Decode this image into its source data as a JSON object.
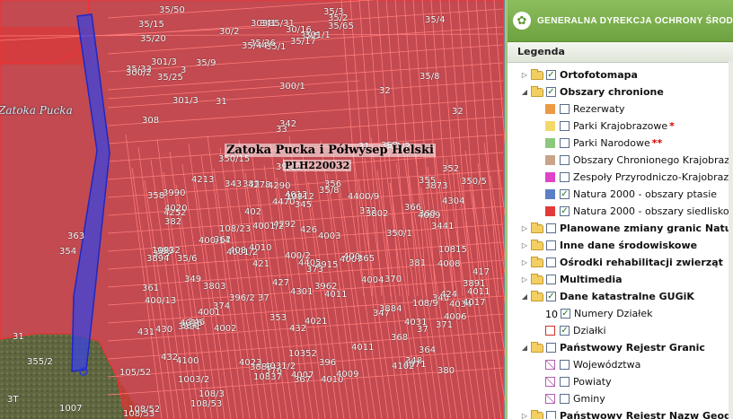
{
  "map": {
    "water_label": "Zatoka Pucka",
    "feature_label": "Zatoka Pucka i Półwysep Helski",
    "feature_code": "PLH220032",
    "colors": {
      "red": "#e23333",
      "blue": "#3a44dd",
      "water": "#6f8599",
      "land": "#6b6b4f"
    },
    "plot_labels": [
      "35/1",
      "35/15",
      "35/36",
      "35/33",
      "35/5",
      "35/9",
      "35/3",
      "35/31",
      "35/2",
      "35/17",
      "35/50",
      "35/8",
      "35/20",
      "35/4",
      "35/44",
      "35/65",
      "35/25",
      "303/1",
      "30/16",
      "301/3",
      "30/2",
      "300/2",
      "3",
      "34",
      "301/1",
      "301/2",
      "301/3",
      "300/1",
      "308",
      "31",
      "32",
      "33",
      "39/12",
      "342",
      "31",
      "32",
      "350/15",
      "355",
      "352",
      "357",
      "356",
      "354",
      "353",
      "350/1",
      "350/5",
      "37",
      "377",
      "417",
      "340",
      "345",
      "348",
      "343",
      "346",
      "347",
      "3441",
      "360",
      "358",
      "361",
      "364",
      "349",
      "363",
      "359",
      "362",
      "366",
      "4213",
      "4400/9",
      "4470",
      "4405",
      "431",
      "432",
      "3883",
      "3884",
      "4001/2",
      "432",
      "3990",
      "400/14",
      "400/13",
      "400/2",
      "396",
      "3915",
      "4100",
      "4004",
      "4006",
      "4007",
      "4008",
      "4021",
      "4071",
      "4010",
      "4011",
      "4012",
      "4011",
      "365",
      "368",
      "373",
      "371",
      "375",
      "367",
      "372",
      "3802",
      "3803",
      "383",
      "3891",
      "3894",
      "4001",
      "4002",
      "4023",
      "4007",
      "4009",
      "421",
      "424",
      "4252",
      "426",
      "427",
      "4278",
      "430",
      "4301",
      "4304",
      "4292",
      "4290",
      "3891",
      "3873",
      "4003",
      "4001/2",
      "370",
      "374",
      "380",
      "376",
      "381",
      "382",
      "384",
      "4009",
      "408",
      "402",
      "4034",
      "4031",
      "396/2",
      "4016",
      "4017",
      "4010",
      "4011",
      "35/6",
      "37",
      "3962",
      "400",
      "4020",
      "4031/2",
      "4102",
      "10352",
      "10812",
      "10815",
      "108/23",
      "10832",
      "10837",
      "108/9",
      "35/8"
    ],
    "bottom_plots": [
      "1003/2",
      "105/52",
      "108/3",
      "108/53",
      "108/52",
      "1007",
      "108/53",
      "355/2",
      "31",
      "3T"
    ]
  },
  "panel": {
    "agency": "GENERALNA DYREKCJA OCHRONY ŚRODOWISKA",
    "legend_title": "Legenda",
    "items": [
      {
        "label": "Ortofotomapa",
        "type": "group",
        "checked": true,
        "expanded": false
      },
      {
        "label": "Obszary chronione",
        "type": "group",
        "checked": true,
        "expanded": true
      },
      {
        "label": "Rezerwaty",
        "type": "layer",
        "checked": false,
        "swatch": "#ee9944"
      },
      {
        "label": "Parki Krajobrazowe",
        "type": "layer",
        "checked": false,
        "swatch": "#f3d96a",
        "star": "*"
      },
      {
        "label": "Parki Narodowe",
        "type": "layer",
        "checked": false,
        "swatch": "#8cc97e",
        "star": "**"
      },
      {
        "label": "Obszary Chronionego Krajobrazu",
        "type": "layer",
        "checked": false,
        "swatch": "#c9a48a",
        "star": "*"
      },
      {
        "label": "Zespoły Przyrodniczo-Krajobrazowe",
        "type": "layer",
        "checked": false,
        "swatch": "#e043c8"
      },
      {
        "label": "Natura 2000 - obszary ptasie",
        "type": "layer",
        "checked": true,
        "swatch": "#5b7fc5"
      },
      {
        "label": "Natura 2000 - obszary siedliskowe",
        "type": "layer",
        "checked": true,
        "swatch": "#e23a3a"
      },
      {
        "label": "Planowane zmiany granic Natura 2000",
        "type": "group",
        "checked": false,
        "expanded": false
      },
      {
        "label": "Inne dane środowiskowe",
        "type": "group",
        "checked": false,
        "expanded": false
      },
      {
        "label": "Ośrodki rehabilitacji zwierząt",
        "type": "group",
        "checked": false,
        "expanded": false
      },
      {
        "label": "Multimedia",
        "type": "group",
        "checked": false,
        "expanded": false
      },
      {
        "label": "Dane katastralne GUGiK",
        "type": "group",
        "checked": true,
        "expanded": true
      },
      {
        "label": "Numery Działek",
        "type": "layer",
        "checked": true,
        "swatch_text": "10"
      },
      {
        "label": "Działki",
        "type": "layer",
        "checked": true,
        "swatch": "outline"
      },
      {
        "label": "Państwowy Rejestr Granic",
        "type": "group",
        "checked": false,
        "expanded": true
      },
      {
        "label": "Województwa",
        "type": "layer",
        "checked": false,
        "swatch": "boundary"
      },
      {
        "label": "Powiaty",
        "type": "layer",
        "checked": false,
        "swatch": "boundary"
      },
      {
        "label": "Gminy",
        "type": "layer",
        "checked": false,
        "swatch": "boundary"
      },
      {
        "label": "Państwowy Rejestr Nazw Geogr.",
        "type": "group",
        "checked": false,
        "expanded": false
      }
    ]
  }
}
